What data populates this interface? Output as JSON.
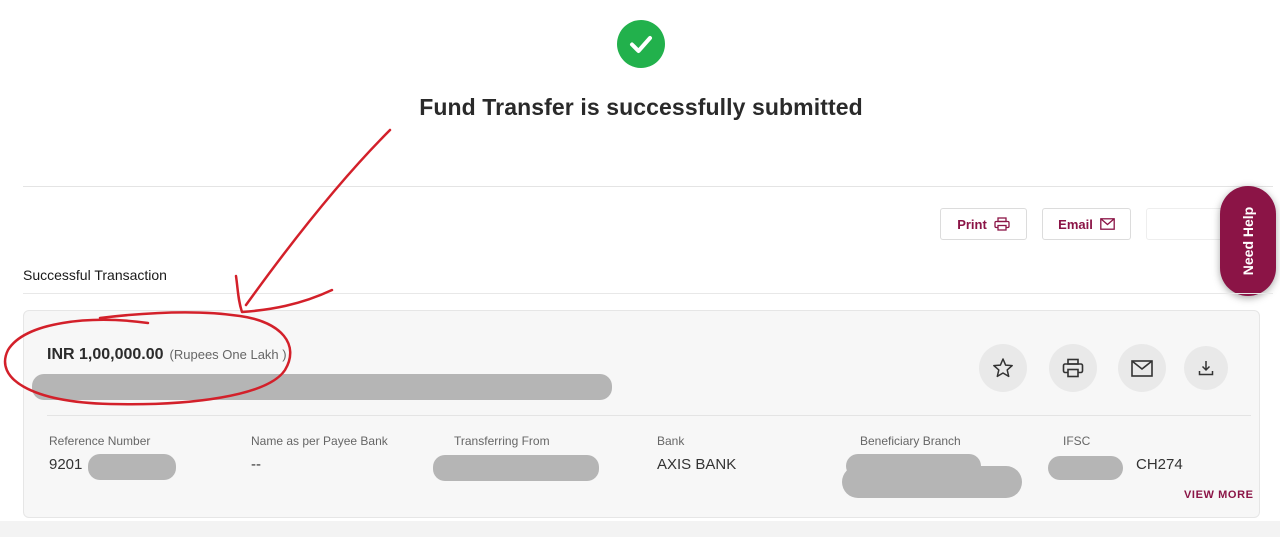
{
  "status": {
    "icon": "check-circle-icon",
    "title": "Fund Transfer is successfully submitted",
    "color": "#22b14c"
  },
  "actions": {
    "print_label": "Print",
    "email_label": "Email",
    "print_icon": "printer-icon",
    "email_icon": "mail-icon"
  },
  "help": {
    "label": "Need Help"
  },
  "section": {
    "label": "Successful Transaction"
  },
  "transaction": {
    "amount": "INR 1,00,000.00",
    "amount_words": "(Rupees One Lakh )",
    "fields": [
      {
        "label": "Reference Number",
        "value": "9201"
      },
      {
        "label": "Name as per Payee Bank",
        "value": "--"
      },
      {
        "label": "Transferring From",
        "value": ""
      },
      {
        "label": "Bank",
        "value": "AXIS BANK"
      },
      {
        "label": "Beneficiary Branch",
        "value": ""
      },
      {
        "label": "IFSC",
        "value": "CH274"
      }
    ],
    "view_more": "VIEW MORE",
    "card_actions": [
      "star-icon",
      "printer-icon",
      "mail-icon",
      "download-icon"
    ]
  },
  "theme": {
    "brand": "#8b1446",
    "annotation": "#d3202a",
    "redaction": "#b5b5b5"
  }
}
